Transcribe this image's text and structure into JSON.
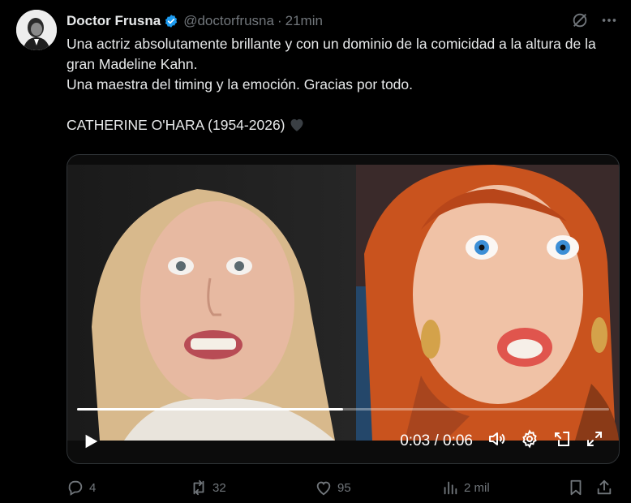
{
  "author": {
    "name": "Doctor Frusna",
    "handle": "@doctorfrusna",
    "separator": "·",
    "time": "21min",
    "verified_color": "#1d9bf0"
  },
  "post": {
    "line1": "Una actriz absolutamente brillante y con un dominio de la comicidad a la altura de la gran Madeline Kahn.",
    "line2": "Una maestra del timing y la emoción. Gracias por todo.",
    "line3": "CATHERINE O'HARA (1954-2026)",
    "line3_emoji": "black-heart-icon"
  },
  "video": {
    "current_time": "0:03",
    "duration": "0:06",
    "time_display": "0:03 / 0:06",
    "progress": 0.5
  },
  "actions": {
    "replies": "4",
    "reposts": "32",
    "likes": "95",
    "views": "2 mil"
  },
  "colors": {
    "background": "#000000",
    "text": "#e7e9ea",
    "muted": "#71767b",
    "accent": "#1d9bf0"
  }
}
